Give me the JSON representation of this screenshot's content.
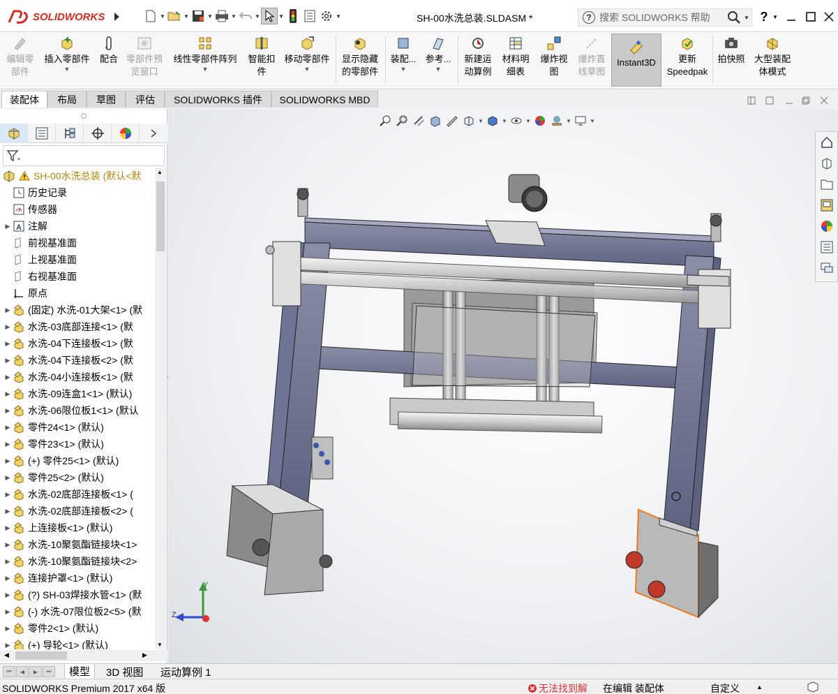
{
  "app": {
    "logo_text": "SOLIDWORKS",
    "window_title": "SH-00水洗总装.SLDASM *",
    "help_placeholder": "搜索 SOLIDWORKS 帮助",
    "help_q": "?",
    "accent": "#d52b1e"
  },
  "ribbon": {
    "edit_part": [
      "编辑零",
      "部件"
    ],
    "insert_part": "插入零部件",
    "mate": "配合",
    "preview": [
      "零部件预",
      "览窗口"
    ],
    "linear_pattern": "线性零部件阵列",
    "smart_fastener": [
      "智能扣",
      "件"
    ],
    "move_part": "移动零部件",
    "show_hidden": [
      "显示隐藏",
      "的零部件"
    ],
    "assembly_features": "装配...",
    "reference": "参考...",
    "new_motion": [
      "新建运",
      "动算例"
    ],
    "bom": [
      "材料明",
      "细表"
    ],
    "explode": [
      "爆炸视",
      "图"
    ],
    "explode_line": [
      "爆炸直",
      "线草图"
    ],
    "instant3d": "Instant3D",
    "speedpak": [
      "更新",
      "Speedpak"
    ],
    "snapshot": "拍快照",
    "large_assembly": [
      "大型装配",
      "体模式"
    ]
  },
  "tabs": [
    "装配体",
    "布局",
    "草图",
    "评估",
    "SOLIDWORKS 插件",
    "SOLIDWORKS MBD"
  ],
  "tree": {
    "root": "SH-00水洗总装  (默认<默",
    "items": [
      "历史记录",
      "传感器",
      "注解",
      "前视基准面",
      "上视基准面",
      "右视基准面",
      "原点",
      "(固定) 水洗-01大架<1> (默",
      "水洗-03底部连接<1> (默",
      "水洗-04下连接板<1> (默",
      "水洗-04下连接板<2> (默",
      "水洗-04小连接板<1> (默",
      "水洗-09连盒1<1> (默认)",
      "水洗-06限位板1<1> (默认",
      "零件24<1> (默认)",
      "零件23<1> (默认)",
      "(+) 零件25<1> (默认)",
      "零件25<2> (默认)",
      "水洗-02底部连接板<1> (",
      "水洗-02底部连接板<2> (",
      "上连接板<1> (默认)",
      "水洗-10聚氨酯链接块<1>",
      "水洗-10聚氨酯链接块<2>",
      "连接护罩<1> (默认)",
      "(?) SH-03焊接水管<1> (默",
      "(-) 水洗-07限位板2<5> (默",
      "零件2<1> (默认)",
      "(+) 导轮<1> (默认)"
    ]
  },
  "triad": {
    "x": "Y",
    "y": "Z"
  },
  "bottom_tabs": [
    "模型",
    "3D 视图",
    "运动算例 1"
  ],
  "status": {
    "product": "SOLIDWORKS Premium 2017 x64 版",
    "error": "无法找到解",
    "mode": "在编辑 装配体",
    "custom": "自定义"
  }
}
